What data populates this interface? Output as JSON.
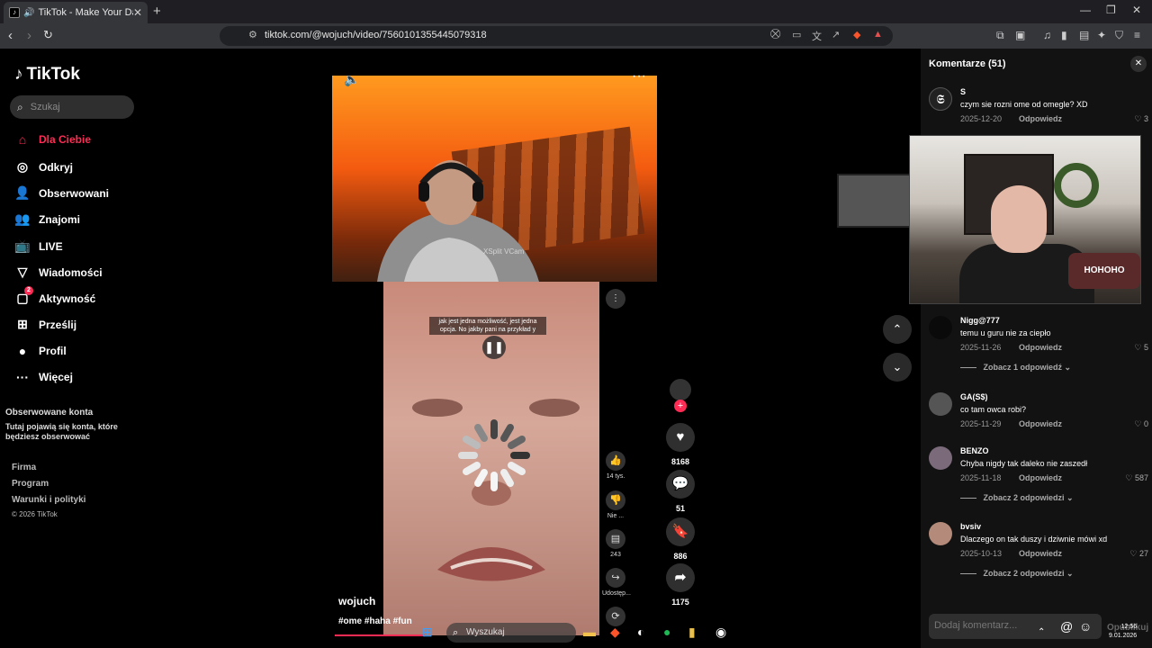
{
  "browser": {
    "tab_title": "TikTok - Make Your Day",
    "url": "tiktok.com/@wojuch/video/7560101355445079318"
  },
  "sidebar": {
    "logo": "TikTok",
    "search_placeholder": "Szukaj",
    "items": [
      {
        "label": "Dla Ciebie",
        "icon": "home-icon"
      },
      {
        "label": "Odkryj",
        "icon": "compass-icon"
      },
      {
        "label": "Obserwowani",
        "icon": "following-icon"
      },
      {
        "label": "Znajomi",
        "icon": "friends-icon"
      },
      {
        "label": "LIVE",
        "icon": "live-icon"
      },
      {
        "label": "Wiadomości",
        "icon": "messages-icon"
      },
      {
        "label": "Aktywność",
        "icon": "activity-icon",
        "badge": "2"
      },
      {
        "label": "Prześlij",
        "icon": "upload-icon"
      },
      {
        "label": "Profil",
        "icon": "profile-icon"
      },
      {
        "label": "Więcej",
        "icon": "more-icon"
      }
    ],
    "followed_title": "Obserwowane konta",
    "followed_desc": "Tutaj pojawią się konta, które będziesz obserwować",
    "footer": [
      "Firma",
      "Program",
      "Warunki i polityki",
      "© 2026 TikTok"
    ]
  },
  "video": {
    "watermark": "XSplit VCam",
    "subtitle": "jak jest jedna możliwość, jest jedna opcja. No jakby pani na przykład y",
    "author": "wojuch",
    "tags": "#ome #haha #fun",
    "inner_actions": [
      {
        "icon": "thumbs-up-icon",
        "label": "14 tys."
      },
      {
        "icon": "thumbs-down-icon",
        "label": "Nie ..."
      },
      {
        "icon": "comment-icon",
        "label": "243"
      },
      {
        "icon": "share-icon",
        "label": "Udostęp..."
      }
    ]
  },
  "actions": {
    "likes": "8168",
    "comments": "51",
    "saves": "886",
    "shares": "1175"
  },
  "comments_panel": {
    "title": "Komentarze (51)",
    "reply_label": "Odpowiedz",
    "comments": [
      {
        "user": "S",
        "text": "czym sie rozni ome od omegle? XD",
        "date": "2025-12-20",
        "likes": "3",
        "more": ""
      },
      {
        "user": "Nigg@777",
        "text": "temu u guru nie za ciepło",
        "date": "2025-11-26",
        "likes": "5",
        "more": "Zobacz 1 odpowiedź"
      },
      {
        "user": "GA(S$)",
        "text": "co tam owca robi?",
        "date": "2025-11-29",
        "likes": "0",
        "more": ""
      },
      {
        "user": "BENZO",
        "text": "Chyba nigdy tak daleko nie zaszedł",
        "date": "2025-11-18",
        "likes": "587",
        "more": "Zobacz 2 odpowiedzi"
      },
      {
        "user": "bvsiv",
        "text": "Dlaczego on tak duszy i dziwnie mówi xd",
        "date": "2025-10-13",
        "likes": "27",
        "more": "Zobacz 2 odpowiedzi"
      }
    ],
    "add_placeholder": "Dodaj komentarz...",
    "post_label": "Opublikuj"
  },
  "webcam": {
    "pillow_text": "HOHOHO"
  },
  "taskbar": {
    "search": "Wyszukaj",
    "time": "12:56",
    "date": "9.01.2026"
  }
}
